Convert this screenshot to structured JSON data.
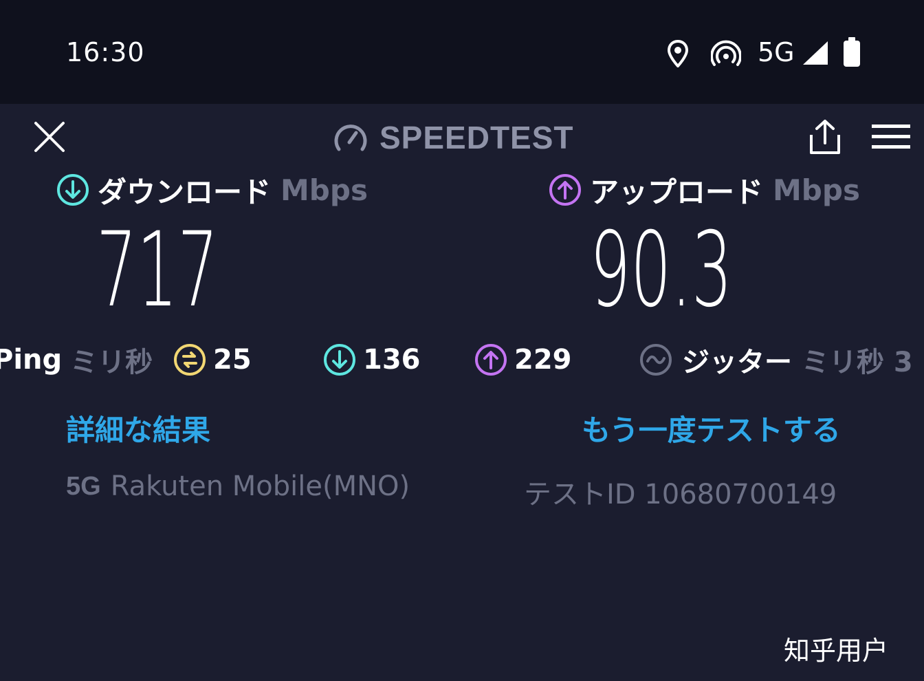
{
  "status_bar": {
    "time": "16:30",
    "network": "5G",
    "icons": [
      "location-icon",
      "hotspot-icon",
      "signal-icon",
      "battery-icon"
    ]
  },
  "toolbar": {
    "close_icon": "close-icon",
    "brand": "SPEEDTEST",
    "share_icon": "share-icon",
    "menu_icon": "menu-icon"
  },
  "download": {
    "label": "ダウンロード",
    "unit": "Mbps",
    "value": "717",
    "color": "#5ee6e0"
  },
  "upload": {
    "label": "アップロード",
    "unit": "Mbps",
    "value": "90.3",
    "color": "#c474f2"
  },
  "stats": {
    "ping_label": "Ping",
    "ping_unit": "ミリ秒",
    "ping_idle": "25",
    "ping_download": "136",
    "ping_upload": "229",
    "jitter_label": "ジッター",
    "jitter_unit": "ミリ秒 3",
    "idle_color": "#f2d773"
  },
  "links": {
    "details": "詳細な結果",
    "retest": "もう一度テストする"
  },
  "footer": {
    "network_badge": "5G",
    "provider": "Rakuten Mobile(MNO)",
    "test_id": "テストID 10680700149"
  },
  "watermark": "知乎用户"
}
